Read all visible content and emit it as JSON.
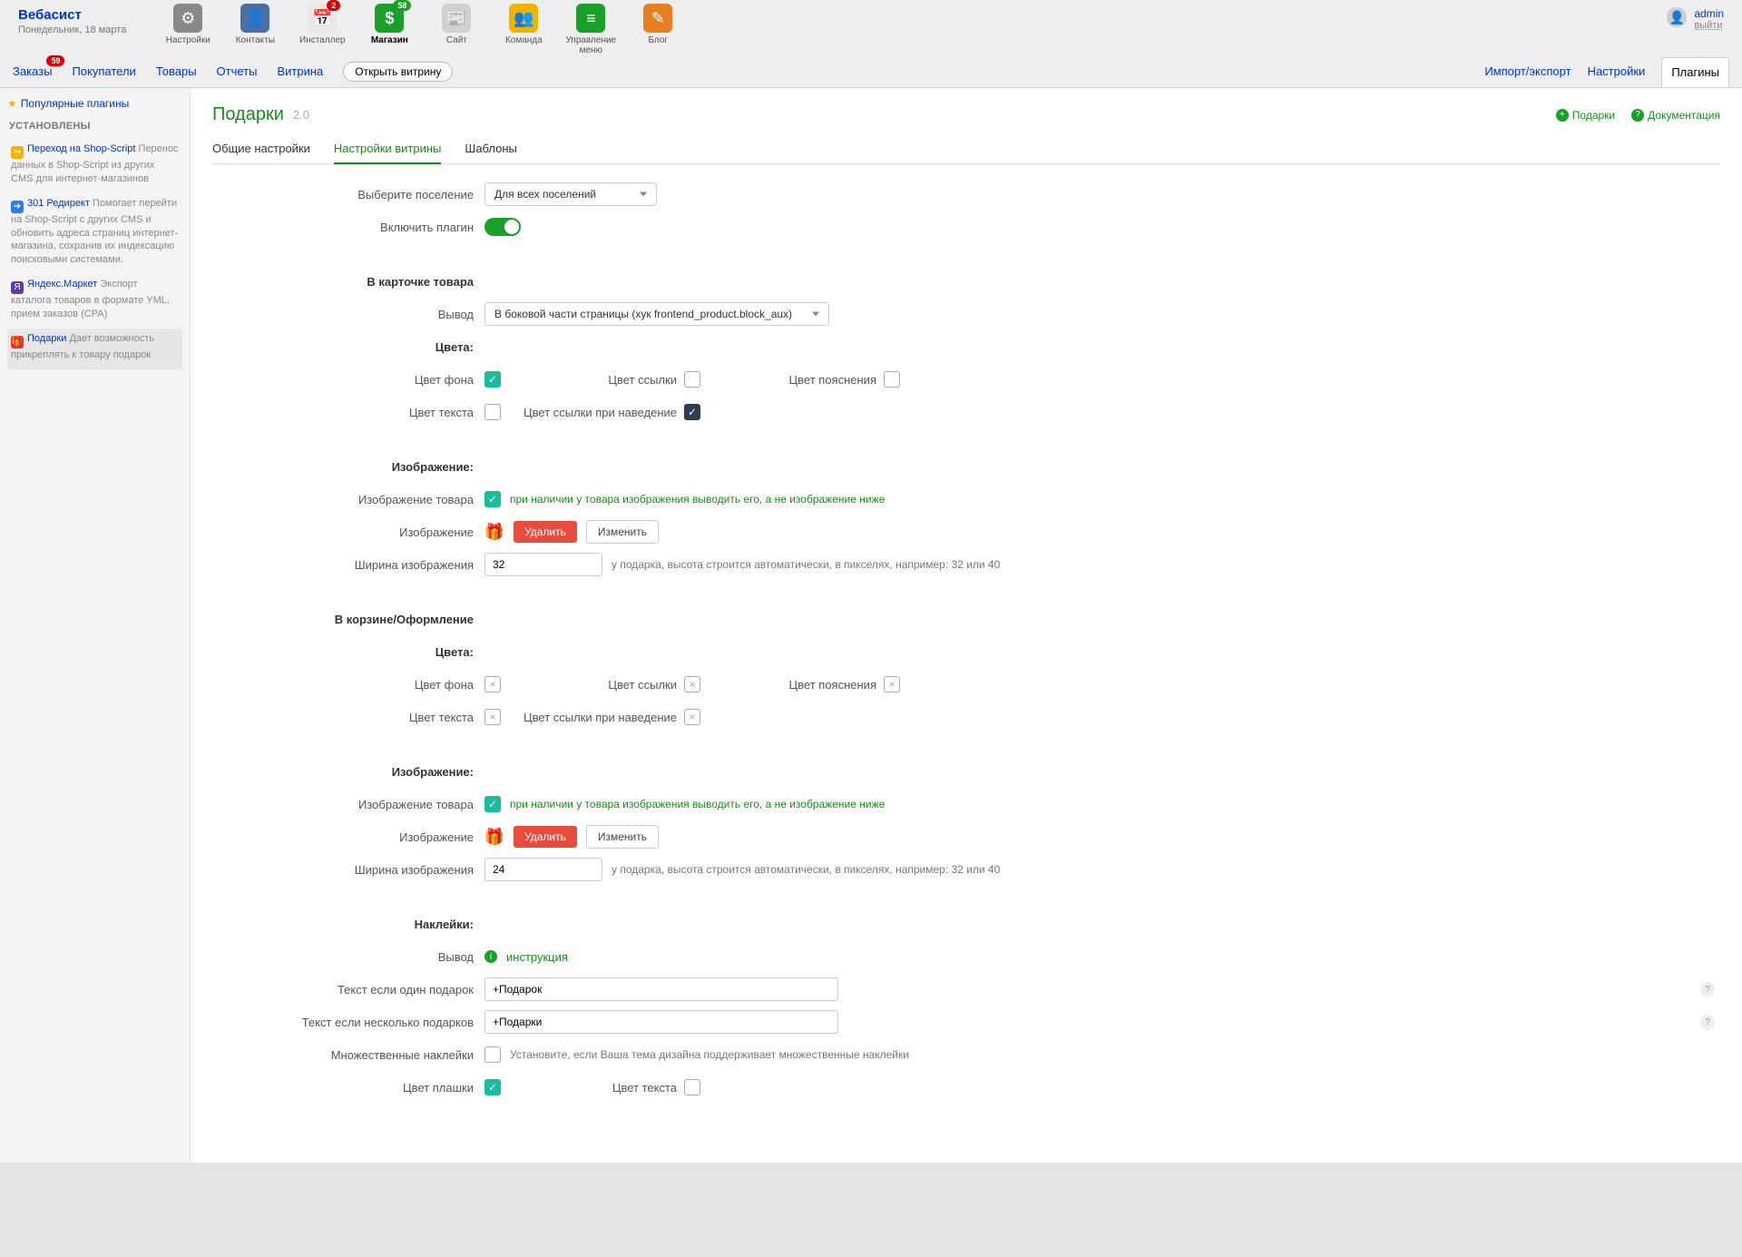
{
  "brand": {
    "title": "Вебасист",
    "date": "Понедельник, 18 марта"
  },
  "apps": [
    {
      "label": "Настройки",
      "icon": "⚙",
      "bg": "#888"
    },
    {
      "label": "Контакты",
      "icon": "👤",
      "bg": "#4a6fa5",
      "badge": null
    },
    {
      "label": "Инсталлер",
      "icon": "📅",
      "bg": "#e8e8e8",
      "badge": "2",
      "badgeClass": "badge-red"
    },
    {
      "label": "Магазин",
      "icon": "$",
      "bg": "#1a9f29",
      "badge": "58",
      "badgeClass": "badge-green",
      "selected": true
    },
    {
      "label": "Сайт",
      "icon": "📰",
      "bg": "#d0d0d0"
    },
    {
      "label": "Команда",
      "icon": "👥",
      "bg": "#f0b400"
    },
    {
      "label": "Управление меню",
      "icon": "≡",
      "bg": "#1a9f29"
    },
    {
      "label": "Блог",
      "icon": "✎",
      "bg": "#e67e22"
    }
  ],
  "user": {
    "name": "admin",
    "logout": "выйти"
  },
  "shopnav": {
    "links": [
      "Заказы",
      "Покупатели",
      "Товары",
      "Отчеты",
      "Витрина"
    ],
    "orders_badge": "59",
    "open": "Открыть витрину",
    "right": [
      "Импорт/экспорт",
      "Настройки",
      "Плагины"
    ],
    "active_right": 2
  },
  "sidebar": {
    "popular": "Популярные плагины",
    "installed": "УСТАНОВЛЕНЫ",
    "items": [
      {
        "title": "Переход на Shop-Script",
        "desc": "Перенос данных в Shop-Script из других CMS для интернет-магазинов",
        "ic": "↪",
        "bg": "#f0b400"
      },
      {
        "title": "301 Редирект",
        "desc": "Помогает перейти на Shop-Script с других CMS и обновить адреса страниц интернет-магазина, сохранив их индексацию поисковыми системами.",
        "ic": "➔",
        "bg": "#2b7de9"
      },
      {
        "title": "Яндекс.Маркет",
        "desc": "Экспорт каталога товаров в формате YML, прием заказов (CPA)",
        "ic": "Я",
        "bg": "#5b3da8"
      },
      {
        "title": "Подарки",
        "desc": "Дает возможность прикреплять к товару подарок",
        "ic": "🎁",
        "bg": "#d33",
        "active": true
      }
    ]
  },
  "page": {
    "title": "Подарки",
    "version": "2.0",
    "actions": [
      {
        "label": "Подарки",
        "ic": "+",
        "bg": "#1a9f29"
      },
      {
        "label": "Документация",
        "ic": "?",
        "bg": "#1a9f29"
      }
    ],
    "tabs": [
      "Общие настройки",
      "Настройки витрины",
      "Шаблоны"
    ],
    "active_tab": 1
  },
  "form": {
    "select_settlement_label": "Выберите поселение",
    "select_settlement_value": "Для всех поселений",
    "enable_label": "Включить плагин",
    "product_card_title": "В карточке товара",
    "output_label": "Вывод",
    "output_value": "В боковой части страницы (хук frontend_product.block_aux)",
    "colors_title": "Цвета:",
    "colors": {
      "bg": "Цвет фона",
      "link": "Цвет ссылки",
      "note": "Цвет пояснения",
      "text": "Цвет текста",
      "link_hover": "Цвет ссылки при наведение"
    },
    "image_title": "Изображение:",
    "product_image_label": "Изображение товара",
    "product_image_desc": "при наличии у товара изображения выводить его, а не изображение ниже",
    "image_label": "Изображение",
    "delete": "Удалить",
    "change": "Изменить",
    "width_label": "Ширина изображения",
    "width1": "32",
    "width2": "24",
    "width_hint": "у подарка, высота строится автоматически, в пикселях, например: 32 или 40",
    "cart_title": "В корзине/Оформление",
    "stickers_title": "Наклейки:",
    "instr": "инструкция",
    "one_gift_label": "Текст если один подарок",
    "one_gift_value": "+Подарок",
    "multi_gift_label": "Текст если несколько подарков",
    "multi_gift_value": "+Подарки",
    "multi_stickers_label": "Множественные наклейки",
    "multi_stickers_desc": "Установите, если Ваша тема дизайна поддерживает множественные наклейки",
    "plate_color": "Цвет плашки",
    "text_color2": "Цвет текста"
  }
}
